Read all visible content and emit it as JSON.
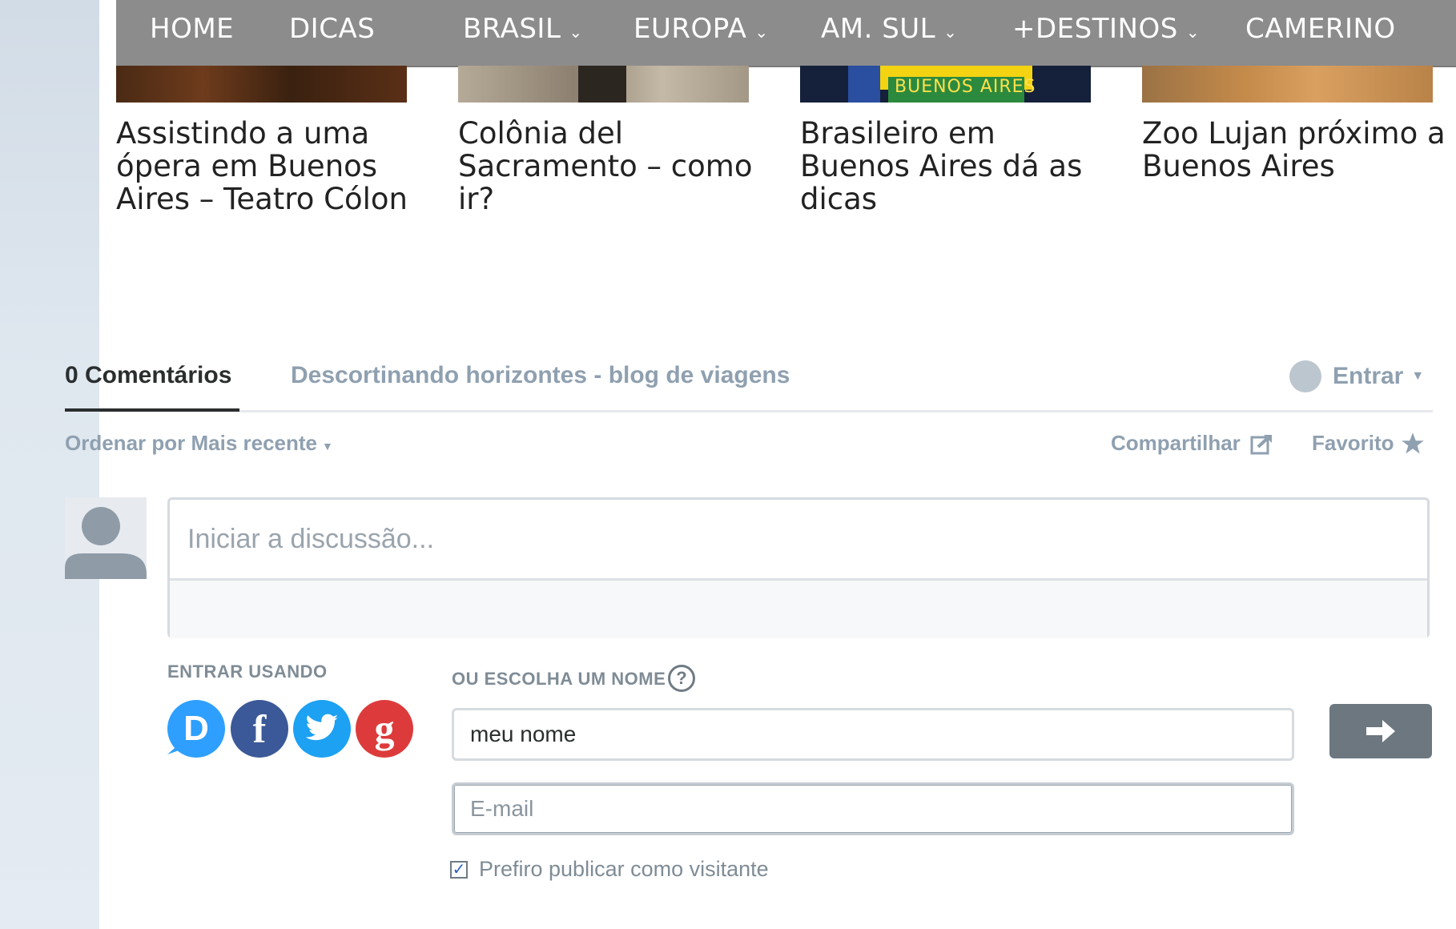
{
  "nav": {
    "items": [
      {
        "label": "HOME"
      },
      {
        "label": "DICAS"
      },
      {
        "label": "BRASIL",
        "dropdown": true
      },
      {
        "label": "EUROPA",
        "dropdown": true
      },
      {
        "label": "AM. SUL",
        "dropdown": true
      },
      {
        "label": "+DESTINOS",
        "dropdown": true
      },
      {
        "label": "CAMERINO"
      }
    ],
    "chevron": "⌄"
  },
  "related_posts": [
    {
      "title": "Assistindo a uma ópera em Buenos Aires – Teatro Cólon"
    },
    {
      "title": "Colônia del Sacramento – como ir?"
    },
    {
      "title": "Brasileiro em Buenos Aires dá as dicas",
      "image_text": "BUENOS AIRES"
    },
    {
      "title": "Zoo Lujan próximo a Buenos Aires"
    }
  ],
  "comments": {
    "count_tab": "0 Comentários",
    "site_tab": "Descortinando horizontes - blog de viagens",
    "login_label": "Entrar",
    "sort_label": "Ordenar por Mais recente",
    "share_label": "Compartilhar",
    "favorite_label": "Favorito",
    "composer_placeholder": "Iniciar a discussão...",
    "login_with_label": "ENTRAR USANDO",
    "choose_name_label": "OU ESCOLHA UM NOME",
    "help_icon_text": "?",
    "social": [
      {
        "name": "disqus",
        "glyph": "D"
      },
      {
        "name": "facebook",
        "glyph": "f"
      },
      {
        "name": "twitter",
        "glyph": ""
      },
      {
        "name": "google",
        "glyph": "g"
      }
    ],
    "name_value": "meu nome",
    "email_placeholder": "E-mail",
    "guest_label": "Prefiro publicar como visitante",
    "guest_checked": true
  },
  "colors": {
    "nav_bg": "#8c8c8c",
    "muted_text": "#8fa0b0",
    "dark_text": "#2a2e2e",
    "disqus_blue": "#2e9fff",
    "facebook_blue": "#3b5998",
    "twitter_blue": "#1da1f2",
    "google_red": "#dd3b3b",
    "submit_bg": "#6c7780"
  }
}
